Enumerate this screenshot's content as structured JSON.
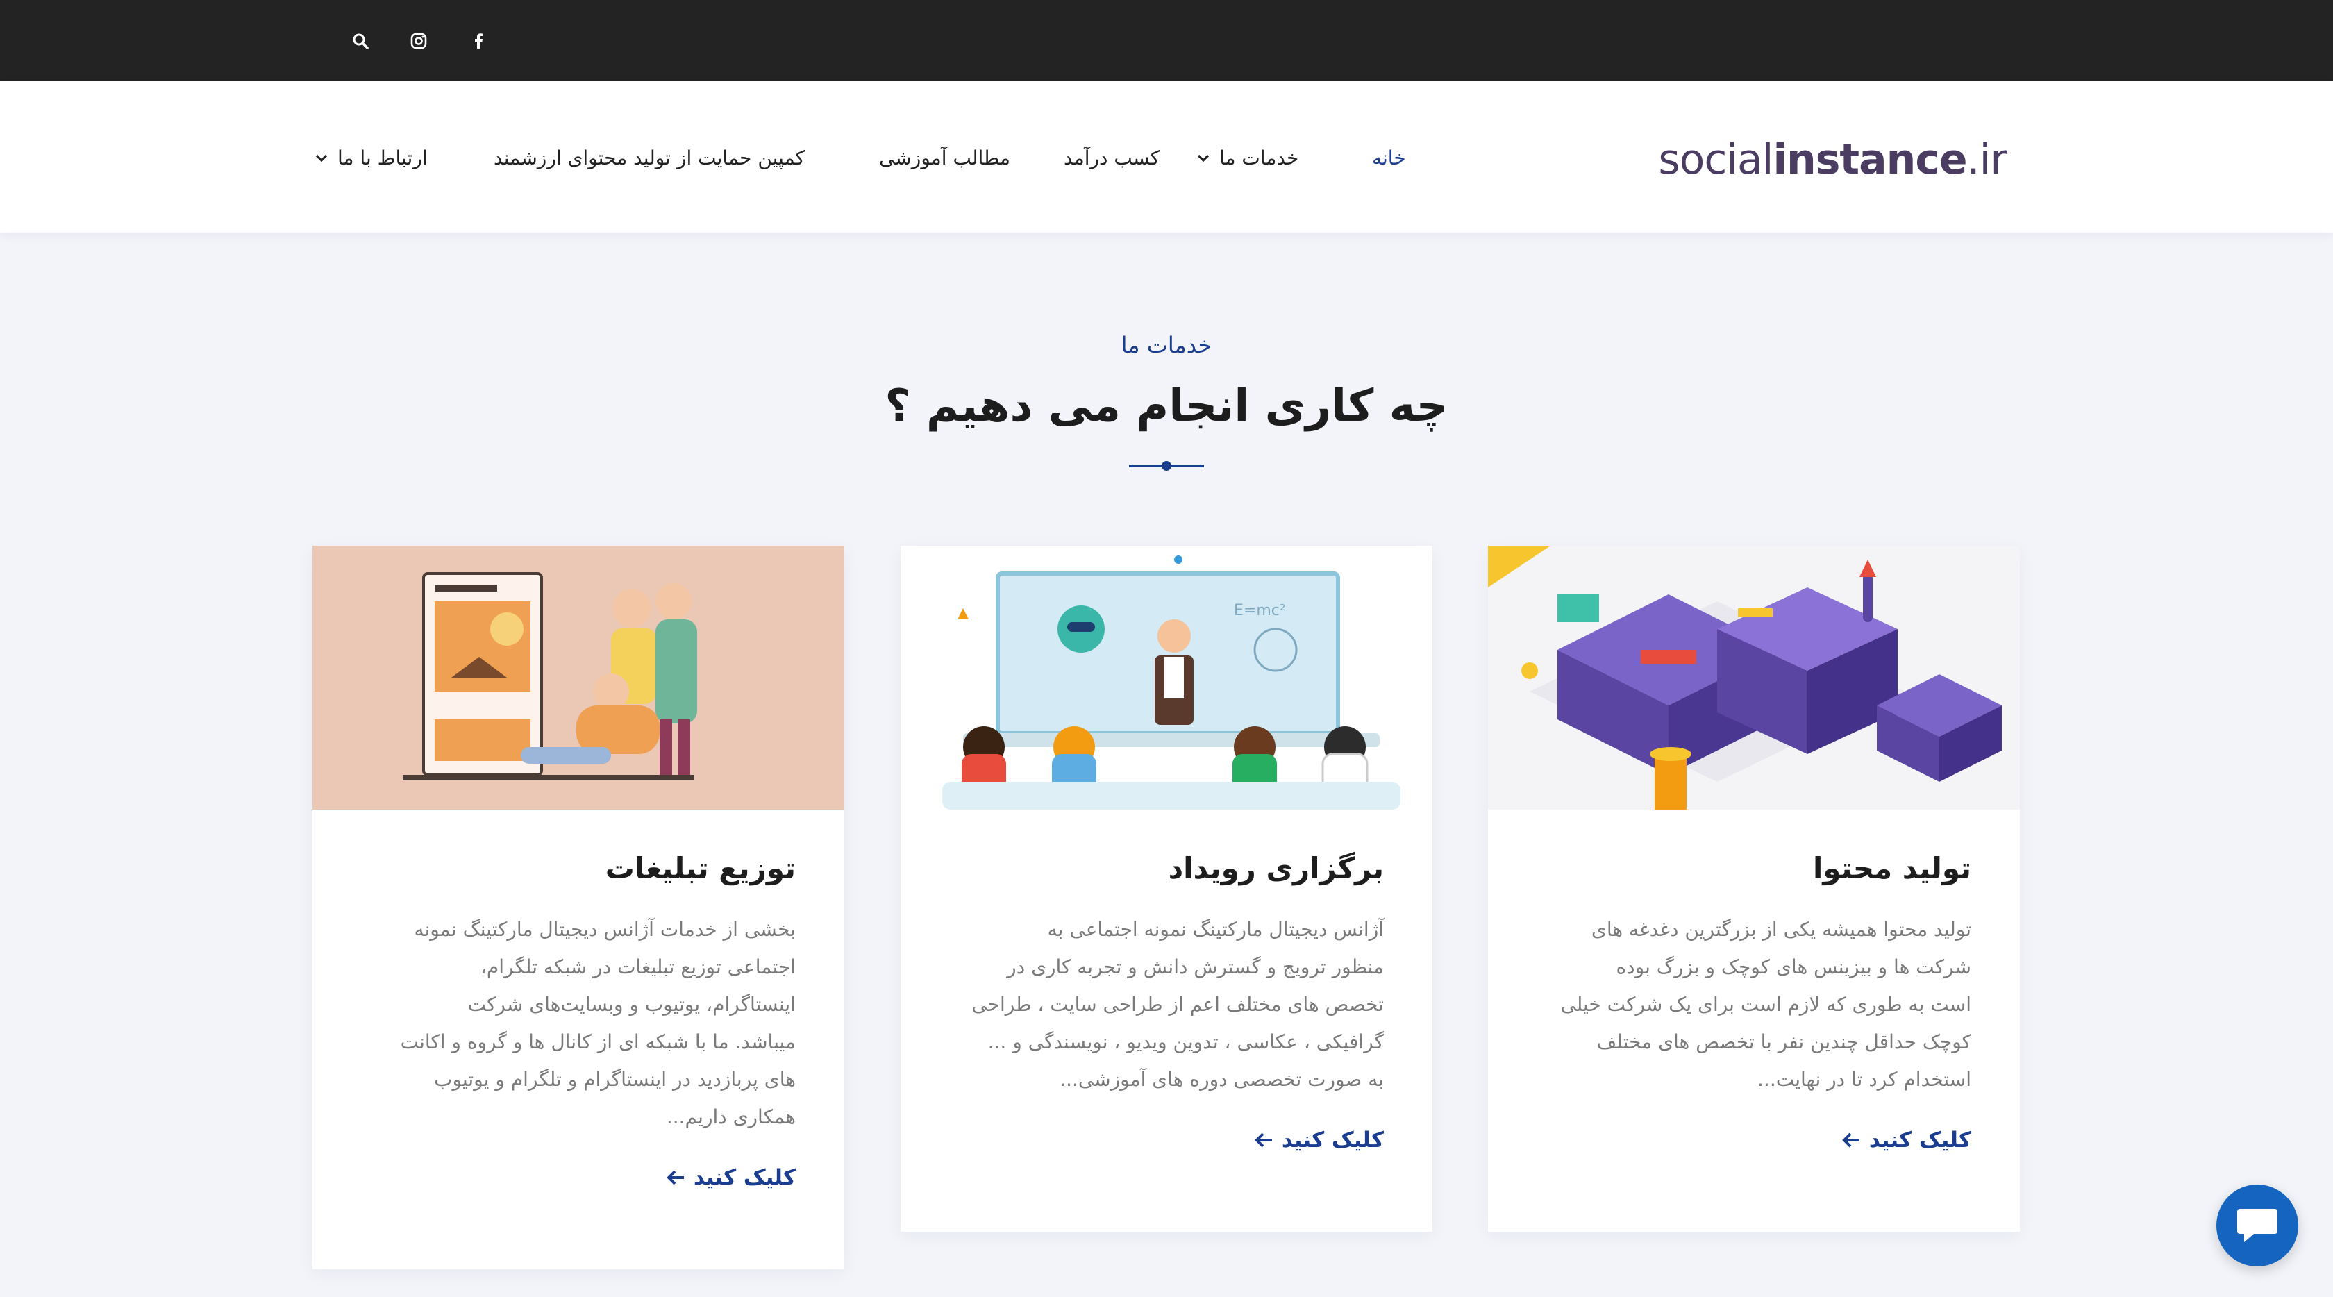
{
  "topbar": {
    "icons": [
      "search-icon",
      "instagram-icon",
      "facebook-icon"
    ],
    "background": "#232323"
  },
  "header": {
    "logo": {
      "light": "social",
      "bold": "instance",
      "suffix": ".ir"
    },
    "nav": [
      {
        "label": "خانه",
        "active": true,
        "dropdown": false
      },
      {
        "label": "خدمات ما",
        "active": false,
        "dropdown": true
      },
      {
        "label": "کسب درآمد",
        "active": false,
        "dropdown": false
      },
      {
        "label": "مطالب آموزشی",
        "active": false,
        "dropdown": false
      },
      {
        "label": "کمپین حمایت از تولید محتوای ارزشمند",
        "active": false,
        "dropdown": false
      },
      {
        "label": "ارتباط با ما",
        "active": false,
        "dropdown": true
      }
    ]
  },
  "section": {
    "kicker": "خدمات ما",
    "title": "چه کاری انجام می دهیم ؟"
  },
  "cards": [
    {
      "title": "تولید محتوا",
      "lines": [
        "تولید محتوا همیشه یکی از بزرگترین دغدغه های",
        "شرکت ها و بیزینس های کوچک و بزرگ بوده",
        "است به طوری که لازم است برای یک شرکت خیلی",
        "کوچک حداقل چندین نفر با تخصص های مختلف",
        "استخدام کرد تا در نهایت..."
      ],
      "cta": "کلیک کنید",
      "image": "isometric-city-illustration"
    },
    {
      "title": "برگزاری رویداد",
      "lines": [
        "آژانس دیجیتال مارکتینگ نمونه اجتماعی به",
        "منظور ترویج و گسترش دانش و تجربه کاری در",
        "تخصص های مختلف اعم از طراحی سایت ، طراحی",
        "گرافیکی ، عکاسی ، تدوین ویدیو ، نویسندگی و ...",
        "به صورت تخصصی دوره های آموزشی..."
      ],
      "cta": "کلیک کنید",
      "image": "classroom-illustration"
    },
    {
      "title": "توزیع تبلیغات",
      "lines": [
        "بخشی از خدمات آژانس دیجیتال مارکتینگ نمونه",
        "اجتماعی توزیع تبلیغات در شبکه تلگرام،",
        "اینستاگرام، یوتیوب و وبسایت‌های شرکت",
        "میباشد. ما با شبکه ای از کانال ها و گروه و اکانت",
        "های پربازدید در اینستاگرام و تلگرام و یوتیوب",
        "همکاری داریم..."
      ],
      "cta": "کلیک کنید",
      "image": "social-media-people-illustration"
    }
  ],
  "chat_widget": {
    "icon": "chat-bubble-icon"
  },
  "colors": {
    "accent": "#1b3d8f",
    "page_bg": "#f2f4f9",
    "chat": "#1565c0"
  }
}
